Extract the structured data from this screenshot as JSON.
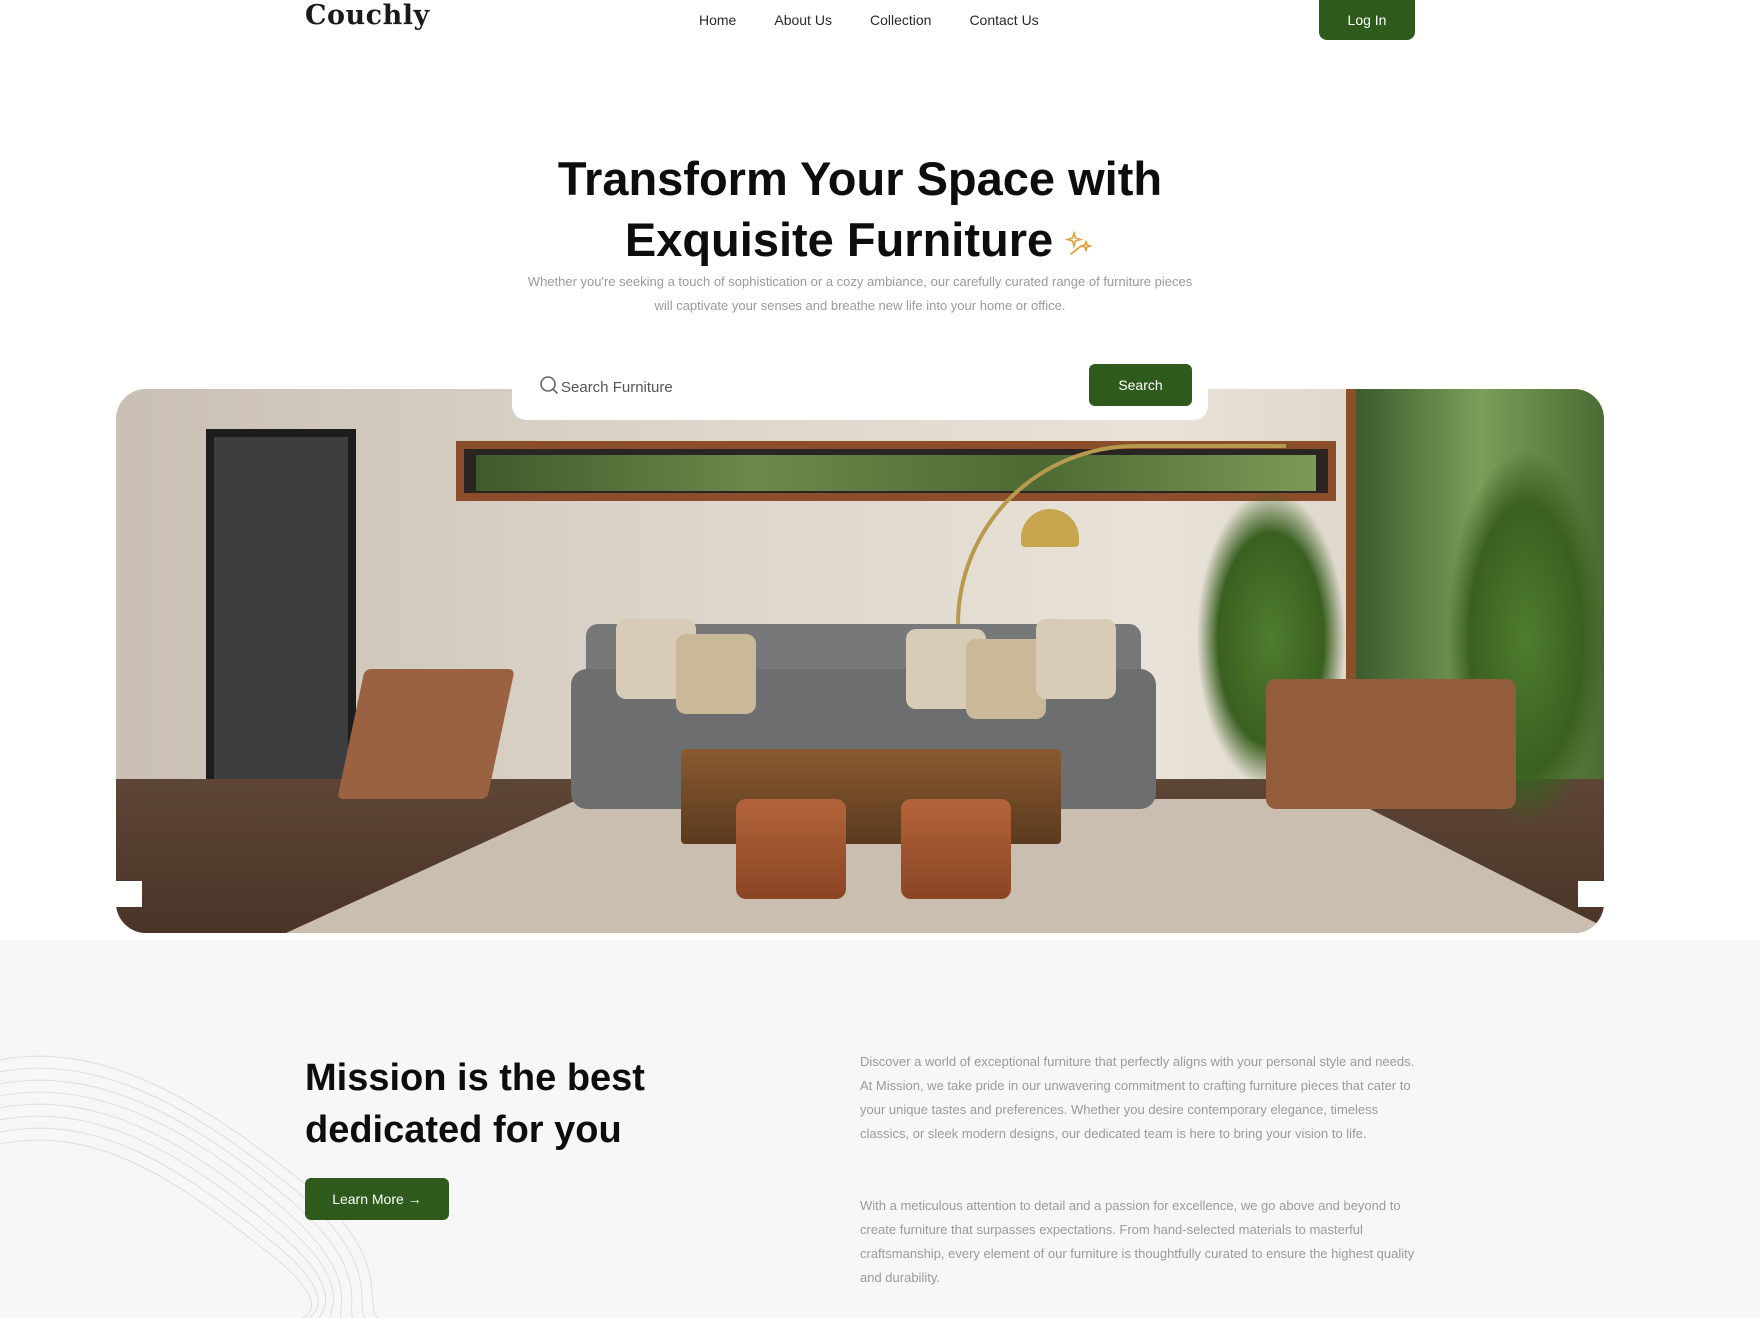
{
  "header": {
    "logo": "Couchly",
    "nav": [
      "Home",
      "About Us",
      "Collection",
      "Contact Us"
    ],
    "login_label": "Log In"
  },
  "hero": {
    "title_line1": "Transform Your Space with",
    "title_line2": "Exquisite Furniture",
    "subtitle": "Whether you're seeking a touch of sophistication or a cozy ambiance, our carefully curated range of furniture pieces will captivate your senses and breathe new life into your home or office."
  },
  "search": {
    "placeholder": "Search Furniture",
    "button_label": "Search"
  },
  "mission": {
    "title": "Mission is the best dedicated for you",
    "button_label": "Learn More",
    "paragraph1": "Discover a world of exceptional furniture that perfectly aligns with your personal style and needs. At Mission, we take pride in our unwavering commitment to crafting furniture pieces that cater to your unique tastes and preferences. Whether you desire contemporary elegance, timeless classics, or sleek modern designs, our dedicated team is here to bring your vision to life.",
    "paragraph2": "With a meticulous attention to detail and a passion for excellence, we go above and beyond to create furniture that surpasses expectations. From hand-selected materials to masterful craftsmanship, every element of our furniture is thoughtfully curated to ensure the highest quality and durability."
  },
  "colors": {
    "accent": "#2e5a1c",
    "sparkle": "#e0a23a",
    "muted_text": "#9a9a9a",
    "section_bg": "#f7f7f7"
  },
  "icons": {
    "sparkle": "sparkle-icon",
    "search": "search-icon",
    "arrow": "arrow-right-icon"
  }
}
